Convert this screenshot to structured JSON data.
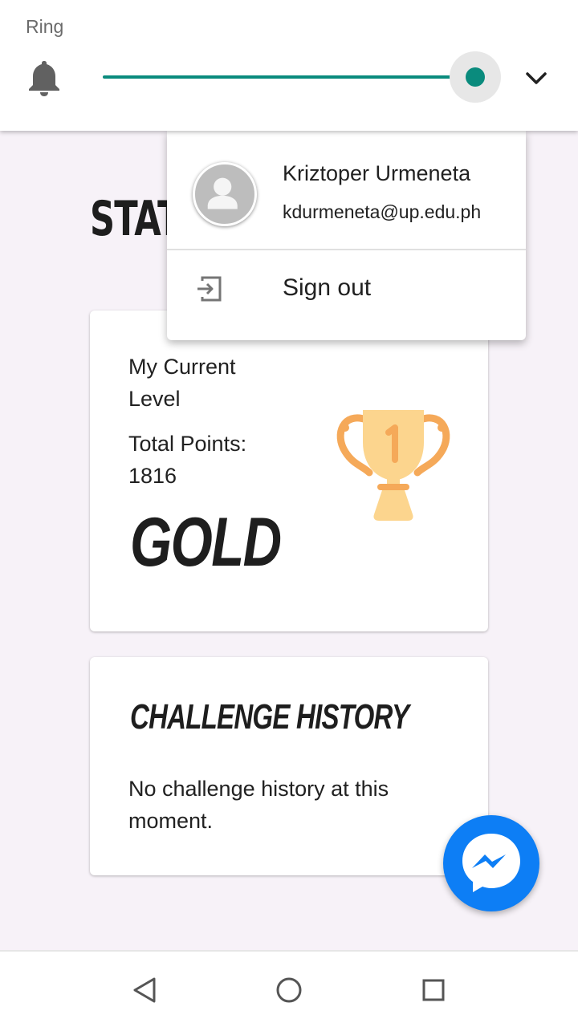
{
  "volume_panel": {
    "label": "Ring",
    "level": 1.0,
    "accent_color": "#0a8b7d",
    "icon": "bell-icon",
    "expand_icon": "chevron-down-icon"
  },
  "page": {
    "title": "STATS"
  },
  "level_card": {
    "caption": "My Current Level",
    "points_label": "Total Points:",
    "points_value": "1816",
    "level": "GOLD",
    "icon": "trophy-icon"
  },
  "history_card": {
    "title": "CHALLENGE HISTORY",
    "empty_message": "No challenge history at this moment."
  },
  "account_menu": {
    "user_name": "Kriztoper Urmeneta",
    "email": "kdurmeneta@up.edu.ph",
    "signout_label": "Sign out",
    "avatar_icon": "person-icon",
    "signout_icon": "exit-icon"
  },
  "fab": {
    "icon": "messenger-icon",
    "color": "#0d7ef5"
  },
  "nav_bar": {
    "buttons": [
      "back-icon",
      "home-icon",
      "recents-icon"
    ]
  }
}
